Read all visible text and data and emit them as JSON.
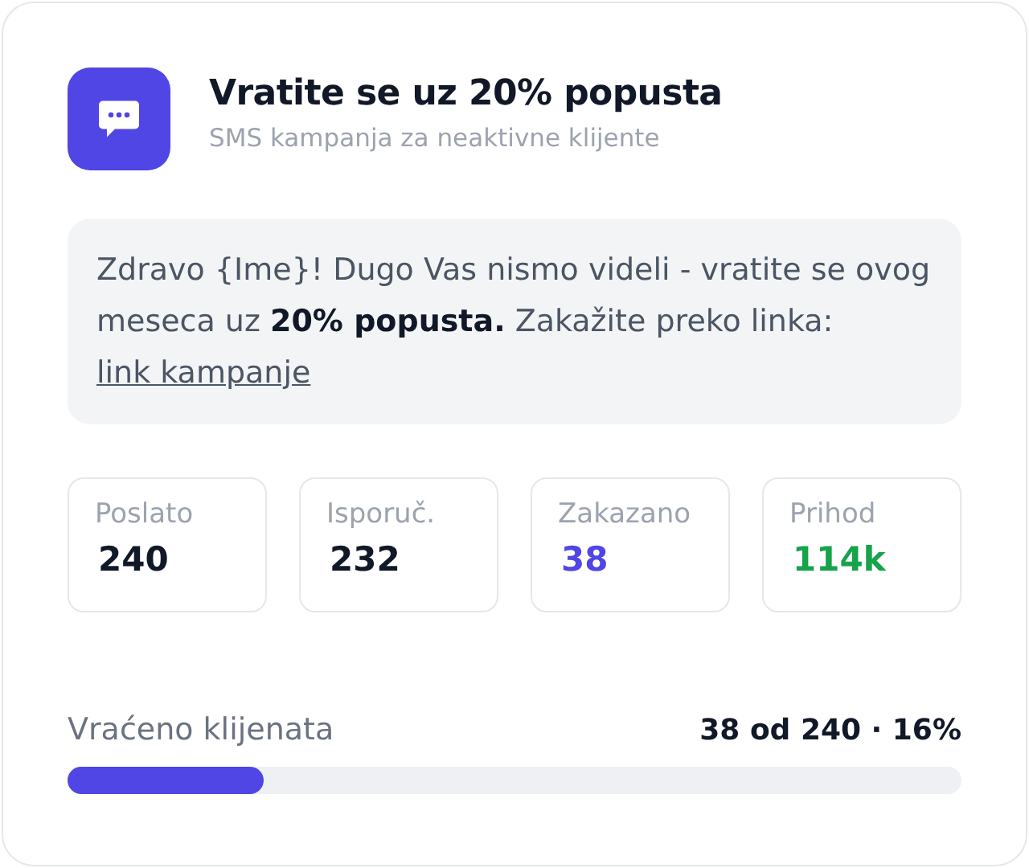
{
  "header": {
    "title": "Vratite se uz 20% popusta",
    "subtitle": "SMS kampanja za neaktivne klijente"
  },
  "message": {
    "text": "Zdravo {Ime}! Dugo Vas nismo videli - vratite se ovog meseca uz **20% popusta.** Zakažite preko linka: ",
    "link": "link kampanje"
  },
  "stats": [
    {
      "label": "Poslato",
      "value": "240",
      "color": "#111827"
    },
    {
      "label": "Isporuč.",
      "value": "232",
      "color": "#111827"
    },
    {
      "label": "Zakazano",
      "value": "38",
      "color": "#4f46e5"
    },
    {
      "label": "Prihod",
      "value": "114k",
      "color": "#16a34a"
    }
  ],
  "progress": {
    "label": "Vraćeno klijenata",
    "reading": "38 od 240 · 16%",
    "level": 0.22
  }
}
